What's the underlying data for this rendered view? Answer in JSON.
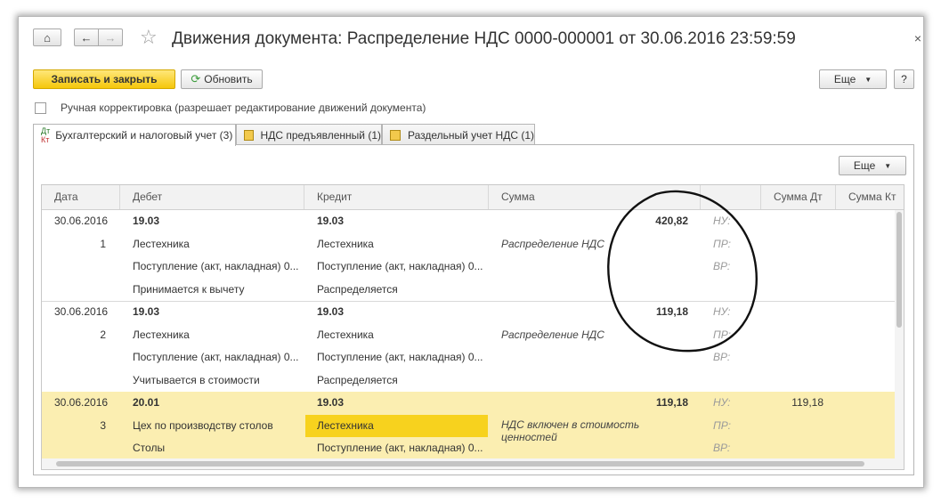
{
  "window": {
    "title": "Движения документа: Распределение НДС 0000-000001 от 30.06.2016 23:59:59",
    "nav": {
      "home_icon": "home-icon",
      "back_icon": "arrow-left-icon",
      "forward_icon": "arrow-right-icon",
      "favorite_icon": "star-icon"
    },
    "close": "×"
  },
  "toolbar": {
    "save_close": "Записать и закрыть",
    "refresh": "Обновить",
    "more": "Еще",
    "help": "?"
  },
  "manual_edit": {
    "checked": false,
    "label": "Ручная корректировка (разрешает редактирование движений документа)"
  },
  "tabs": [
    {
      "label": "Бухгалтерский и налоговый учет (3)",
      "icon": "dt-kt-icon",
      "active": true
    },
    {
      "label": "НДС предъявленный (1)",
      "icon": "register-icon",
      "active": false
    },
    {
      "label": "Раздельный учет НДС (1)",
      "icon": "register-icon",
      "active": false
    }
  ],
  "panel": {
    "more": "Еще"
  },
  "grid": {
    "columns": [
      "Дата",
      "Дебет",
      "Кредит",
      "Сумма",
      "",
      "Сумма Дт",
      "Сумма Кт"
    ],
    "rows": [
      {
        "date": "30.06.2016",
        "num": "1",
        "debit": [
          "19.03",
          "Лестехника",
          "Поступление (акт, накладная) 0...",
          "Принимается к вычету"
        ],
        "credit": [
          "19.03",
          "Лестехника",
          "Поступление (акт, накладная) 0...",
          "Распределяется"
        ],
        "amount": "420,82",
        "content": "Распределение НДС",
        "tax_labels": [
          "НУ:",
          "ПР:",
          "ВР:"
        ],
        "sum_dt": "",
        "sum_kt": "",
        "selected": false
      },
      {
        "date": "30.06.2016",
        "num": "2",
        "debit": [
          "19.03",
          "Лестехника",
          "Поступление (акт, накладная) 0...",
          "Учитывается в стоимости"
        ],
        "credit": [
          "19.03",
          "Лестехника",
          "Поступление (акт, накладная) 0...",
          "Распределяется"
        ],
        "amount": "119,18",
        "content": "Распределение НДС",
        "tax_labels": [
          "НУ:",
          "ПР:",
          "ВР:"
        ],
        "sum_dt": "",
        "sum_kt": "",
        "selected": false
      },
      {
        "date": "30.06.2016",
        "num": "3",
        "debit": [
          "20.01",
          "Цех по производству столов",
          "Столы",
          ""
        ],
        "credit": [
          "19.03",
          "Лестехника",
          "Поступление (акт, накладная) 0...",
          ""
        ],
        "amount": "119,18",
        "content": "НДС включен в стоимость ценностей",
        "tax_labels": [
          "НУ:",
          "ПР:",
          "ВР:"
        ],
        "sum_dt": "119,18",
        "sum_kt": "",
        "selected": true
      }
    ]
  },
  "annotation": {
    "color": "#111111"
  },
  "colors": {
    "primary_button": "#f5c70a",
    "selected_row": "#fbeeb1",
    "selected_cell": "#f7d21e"
  }
}
